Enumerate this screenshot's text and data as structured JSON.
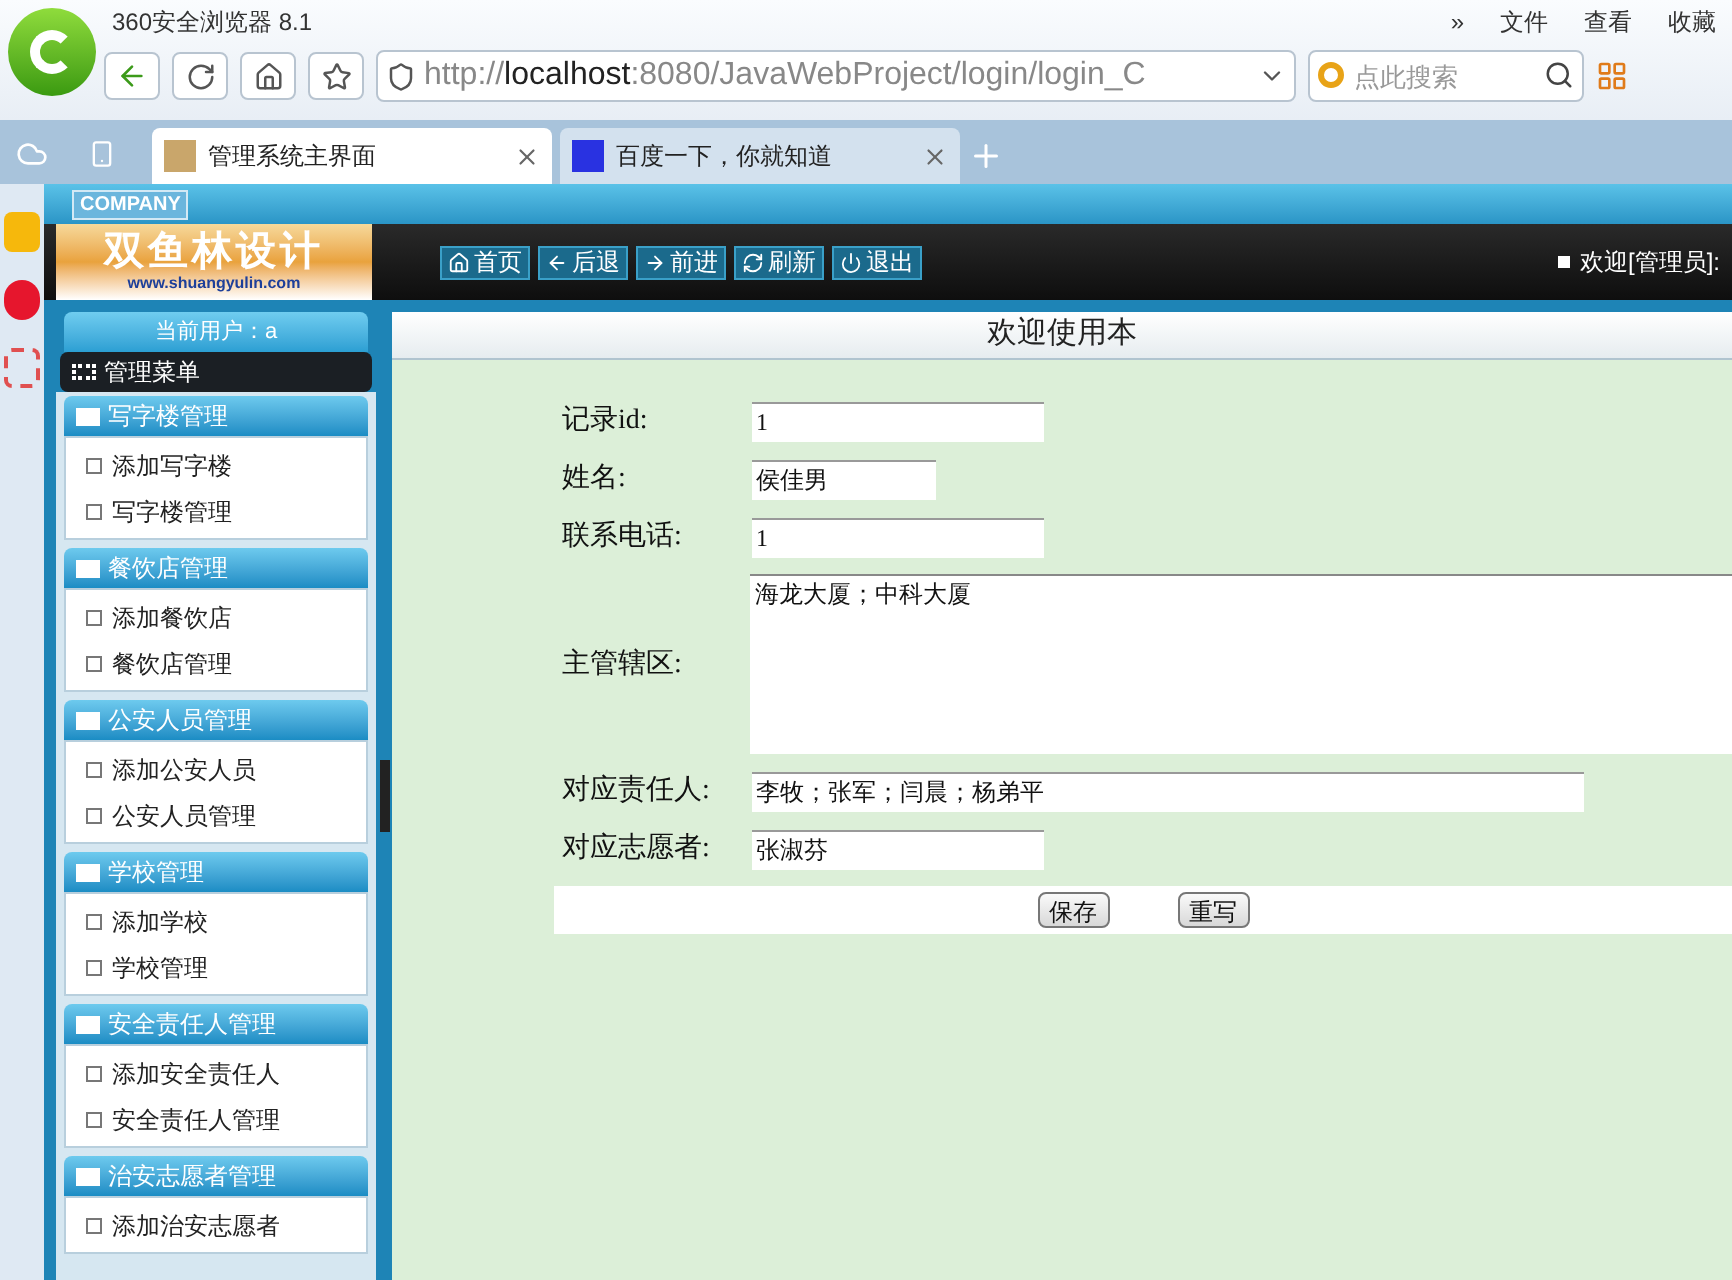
{
  "browser": {
    "title": "360安全浏览器 8.1",
    "menu": [
      "»",
      "文件",
      "查看",
      "收藏"
    ],
    "url_prefix": "http://",
    "url_host": "localhost",
    "url_rest": ":8080/JavaWebProject/login/login_C",
    "search": {
      "placeholder": "点此搜索"
    },
    "tabs": [
      {
        "label": "管理系统主界面",
        "selected": true
      },
      {
        "label": "百度一下，你就知道",
        "selected": false
      }
    ]
  },
  "header": {
    "company": "COMPANY",
    "logo": "双鱼林设计",
    "logo_url": "www.shuangyulin.com",
    "nav": [
      {
        "kind": "home",
        "label": "首页"
      },
      {
        "kind": "back",
        "label": "后退"
      },
      {
        "kind": "forward",
        "label": "前进"
      },
      {
        "kind": "refresh",
        "label": "刷新"
      },
      {
        "kind": "logout",
        "label": "退出"
      }
    ],
    "welcome": "欢迎[管理员]:"
  },
  "sidebar": {
    "user": "当前用户：a",
    "menu_title": "管理菜单",
    "groups": [
      {
        "title": "写字楼管理",
        "items": [
          "添加写字楼",
          "写字楼管理"
        ]
      },
      {
        "title": "餐饮店管理",
        "items": [
          "添加餐饮店",
          "餐饮店管理"
        ]
      },
      {
        "title": "公安人员管理",
        "items": [
          "添加公安人员",
          "公安人员管理"
        ]
      },
      {
        "title": "学校管理",
        "items": [
          "添加学校",
          "学校管理"
        ]
      },
      {
        "title": "安全责任人管理",
        "items": [
          "添加安全责任人",
          "安全责任人管理"
        ]
      },
      {
        "title": "治安志愿者管理",
        "items": [
          "添加治安志愿者"
        ]
      }
    ]
  },
  "main": {
    "title": "欢迎使用本",
    "fields": [
      {
        "kind": "medium",
        "label": "记录id:",
        "value": "1"
      },
      {
        "kind": "short",
        "label": "姓名:",
        "value": "侯佳男"
      },
      {
        "kind": "medium",
        "label": "联系电话:",
        "value": "1"
      },
      {
        "kind": "textarea",
        "label": "主管辖区:",
        "value": "海龙大厦；中科大厦"
      },
      {
        "kind": "wide",
        "label": "对应责任人:",
        "value": "李牧；张军；闫晨；杨弟平"
      },
      {
        "kind": "medium",
        "label": "对应志愿者:",
        "value": "张淑芬"
      }
    ],
    "buttons": [
      "保存",
      "重写"
    ]
  }
}
